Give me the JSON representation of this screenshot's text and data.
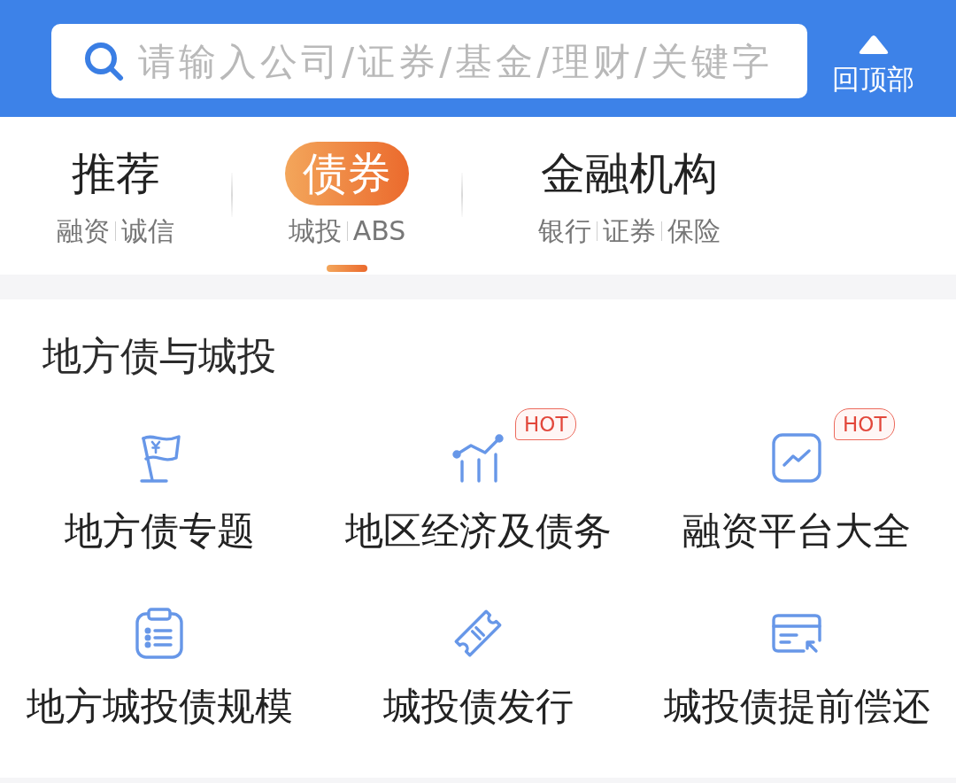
{
  "search": {
    "placeholder": "请输入公司/证券/基金/理财/关键字"
  },
  "back_to_top": {
    "label": "回顶部"
  },
  "tabs": [
    {
      "label": "推荐",
      "sublabels": [
        "融资",
        "诚信"
      ],
      "selected": false
    },
    {
      "label": "债券",
      "sublabels": [
        "城投",
        "ABS"
      ],
      "selected": true
    },
    {
      "label": "金融机构",
      "sublabels": [
        "银行",
        "证券",
        "保险"
      ],
      "selected": false
    }
  ],
  "section": {
    "title": "地方债与城投",
    "items": [
      {
        "label": "地方债专题"
      },
      {
        "label": "地区经济及债务",
        "badge": "HOT"
      },
      {
        "label": "融资平台大全",
        "badge": "HOT"
      },
      {
        "label": "地方城投债规模"
      },
      {
        "label": "城投债发行"
      },
      {
        "label": "城投债提前偿还"
      }
    ]
  }
}
